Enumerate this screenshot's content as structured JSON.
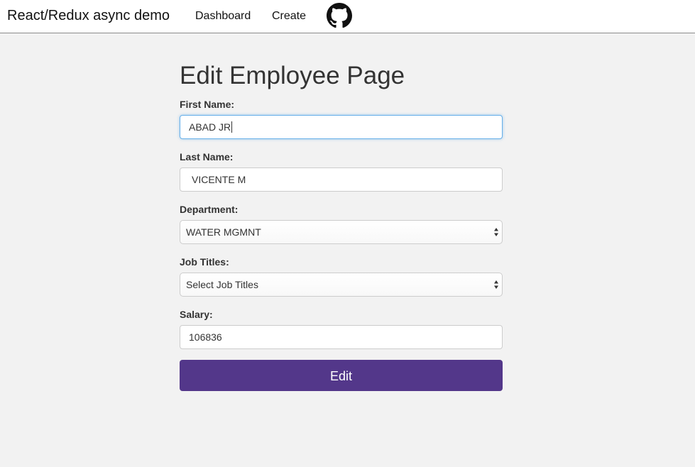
{
  "nav": {
    "brand": "React/Redux async demo",
    "links": [
      "Dashboard",
      "Create"
    ],
    "github_icon": "github-icon"
  },
  "page": {
    "title": "Edit Employee Page"
  },
  "form": {
    "first_name": {
      "label": "First Name:",
      "value": "ABAD JR"
    },
    "last_name": {
      "label": "Last Name:",
      "value": "VICENTE M"
    },
    "department": {
      "label": "Department:",
      "selected": "WATER MGMNT"
    },
    "job_titles": {
      "label": "Job Titles:",
      "selected": "Select Job Titles"
    },
    "salary": {
      "label": "Salary:",
      "value": "106836"
    },
    "submit_label": "Edit"
  },
  "colors": {
    "accent": "#53378a",
    "focus_border": "#66afe9",
    "background": "#f2f2f2"
  }
}
